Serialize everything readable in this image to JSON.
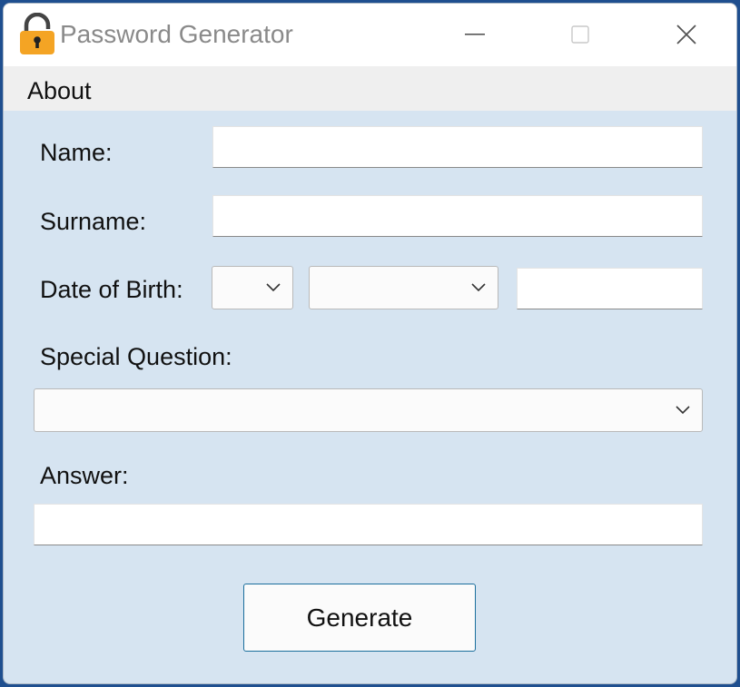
{
  "window": {
    "title": "Password Generator",
    "icon": "padlock-icon",
    "controls": [
      "minimize-icon",
      "maximize-icon",
      "close-icon"
    ]
  },
  "menu": {
    "items": [
      {
        "label": "About"
      }
    ]
  },
  "form": {
    "name_label": "Name:",
    "name_value": "",
    "surname_label": "Surname:",
    "surname_value": "",
    "dob_label": "Date of Birth:",
    "dob_day_value": "",
    "dob_month_value": "",
    "dob_year_value": "",
    "special_question_label": "Special Question:",
    "special_question_value": "",
    "answer_label": "Answer:",
    "answer_value": "",
    "generate_label": "Generate"
  },
  "colors": {
    "window_background": "#d6e4f1",
    "titlebar": "#ffffff",
    "menubar": "#efefef",
    "button_border": "#1a6e9c",
    "icon_lock": "#f4a424"
  }
}
